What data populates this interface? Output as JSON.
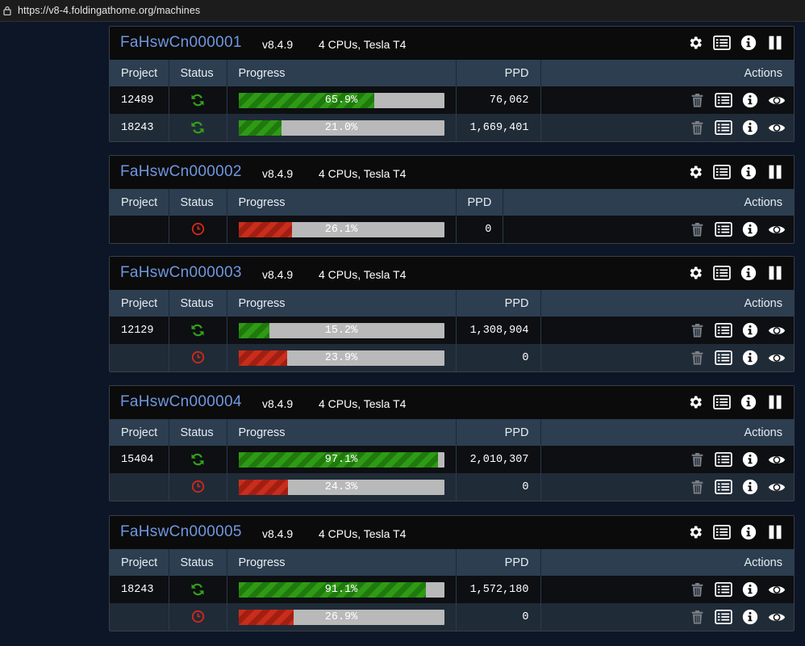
{
  "browser": {
    "url": "https://v8-4.foldingathome.org/machines"
  },
  "headers": {
    "project": "Project",
    "status": "Status",
    "progress": "Progress",
    "ppd": "PPD",
    "actions": "Actions"
  },
  "colors": {
    "accent": "#6f97e0",
    "running": "#2f9a16",
    "waiting": "#c92d1b"
  },
  "machines": [
    {
      "name": "FaHswCn000001",
      "version": "v8.4.9",
      "desc": "4 CPUs, Tesla T4",
      "units": [
        {
          "project": "12489",
          "status": "running",
          "progress": 0.659,
          "progress_label": "65.9%",
          "ppd": "76,062"
        },
        {
          "project": "18243",
          "status": "running",
          "progress": 0.21,
          "progress_label": "21.0%",
          "ppd": "1,669,401"
        }
      ]
    },
    {
      "name": "FaHswCn000002",
      "version": "v8.4.9",
      "desc": "4 CPUs, Tesla T4",
      "units": [
        {
          "project": "",
          "status": "waiting",
          "progress": 0.261,
          "progress_label": "26.1%",
          "ppd": "0"
        }
      ]
    },
    {
      "name": "FaHswCn000003",
      "version": "v8.4.9",
      "desc": "4 CPUs, Tesla T4",
      "units": [
        {
          "project": "12129",
          "status": "running",
          "progress": 0.152,
          "progress_label": "15.2%",
          "ppd": "1,308,904"
        },
        {
          "project": "",
          "status": "waiting",
          "progress": 0.239,
          "progress_label": "23.9%",
          "ppd": "0"
        }
      ]
    },
    {
      "name": "FaHswCn000004",
      "version": "v8.4.9",
      "desc": "4 CPUs, Tesla T4",
      "units": [
        {
          "project": "15404",
          "status": "running",
          "progress": 0.971,
          "progress_label": "97.1%",
          "ppd": "2,010,307"
        },
        {
          "project": "",
          "status": "waiting",
          "progress": 0.243,
          "progress_label": "24.3%",
          "ppd": "0"
        }
      ]
    },
    {
      "name": "FaHswCn000005",
      "version": "v8.4.9",
      "desc": "4 CPUs, Tesla T4",
      "units": [
        {
          "project": "18243",
          "status": "running",
          "progress": 0.911,
          "progress_label": "91.1%",
          "ppd": "1,572,180"
        },
        {
          "project": "",
          "status": "waiting",
          "progress": 0.269,
          "progress_label": "26.9%",
          "ppd": "0"
        }
      ]
    }
  ]
}
